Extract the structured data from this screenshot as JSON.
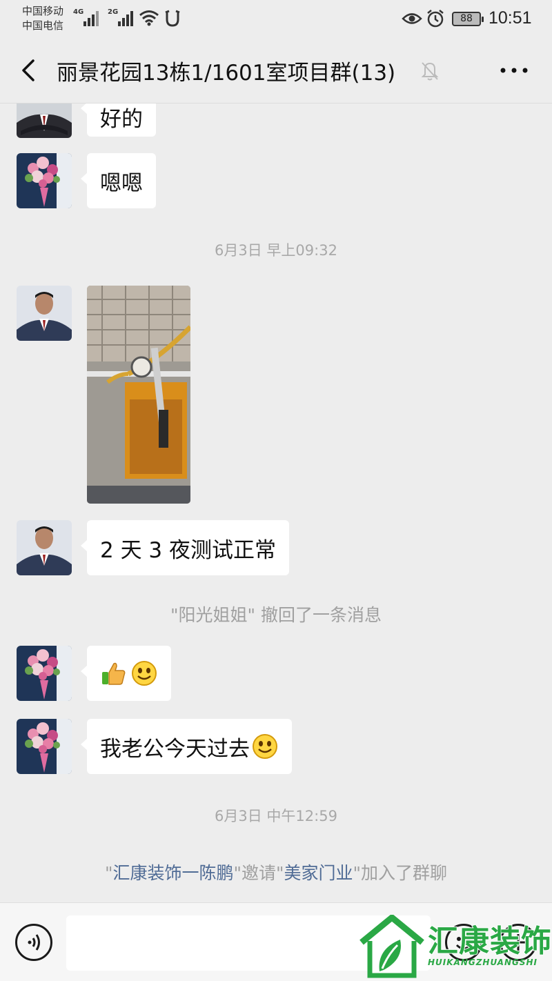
{
  "status_bar": {
    "carrier_1": "中国移动",
    "carrier_2": "中国电信",
    "network_1": "4G",
    "network_2": "2G",
    "battery": "88",
    "time": "10:51"
  },
  "header": {
    "title": "丽景花园13栋1/1601室项目群(13)",
    "icons": [
      "back-arrow-icon",
      "mute-bell-icon",
      "more-icon"
    ]
  },
  "messages": [
    {
      "sender": "man-in-suit",
      "type": "text",
      "text": "好的"
    },
    {
      "sender": "flower-bouquet",
      "type": "text",
      "text": "嗯嗯"
    },
    {
      "type": "timestamp",
      "text": "6月3日 早上09:32"
    },
    {
      "sender": "man-in-suit",
      "type": "image",
      "content": "pressure-test-pump-photo"
    },
    {
      "sender": "man-in-suit",
      "type": "text",
      "text": "2 天 3 夜测试正常"
    },
    {
      "type": "system",
      "text": "\"阳光姐姐\" 撤回了一条消息"
    },
    {
      "sender": "flower-bouquet",
      "type": "emoji",
      "emojis": [
        "thumbs-up",
        "smile"
      ]
    },
    {
      "sender": "flower-bouquet",
      "type": "text",
      "text": "我老公今天过去"
    },
    {
      "type": "timestamp",
      "text": "6月3日 中午12:59"
    },
    {
      "type": "system_invite",
      "parts": [
        "\"",
        "汇康装饰一陈鹏",
        "\"邀请\"",
        "美家门业",
        "\"加入了群聊"
      ]
    }
  ],
  "input_bar": {
    "value": "",
    "icons": [
      "voice-icon",
      "emoji-icon",
      "plus-icon"
    ]
  },
  "watermark": {
    "text": "汇康装饰",
    "subtext": "HUIKANGZHUANGSHI",
    "color": "#2aa845"
  },
  "colors": {
    "background": "#ededed",
    "bubble": "#ffffff",
    "system_name": "#4f6b95",
    "timestamp": "#a8a8a8"
  }
}
